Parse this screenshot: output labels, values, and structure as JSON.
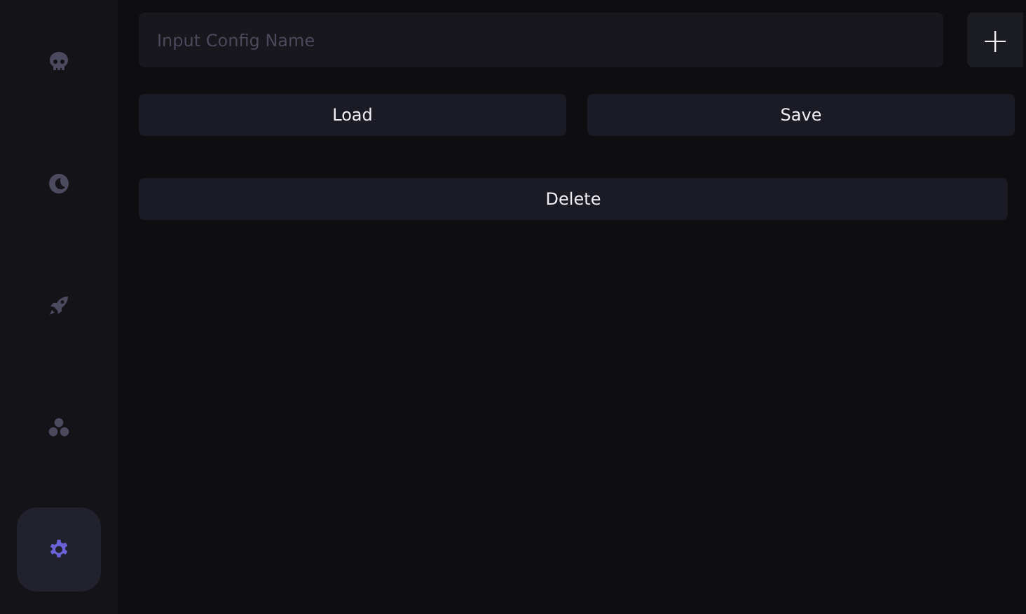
{
  "sidebar": {
    "items": [
      {
        "kind": "skull",
        "selected": false
      },
      {
        "kind": "moon",
        "selected": false
      },
      {
        "kind": "rocket",
        "selected": false
      },
      {
        "kind": "circles",
        "selected": false
      },
      {
        "kind": "gear",
        "selected": true
      }
    ]
  },
  "config": {
    "name_field": {
      "placeholder": "Input Config Name"
    },
    "add_button": "+",
    "load_button": "Load",
    "save_button": "Save",
    "delete_button": "Delete"
  }
}
